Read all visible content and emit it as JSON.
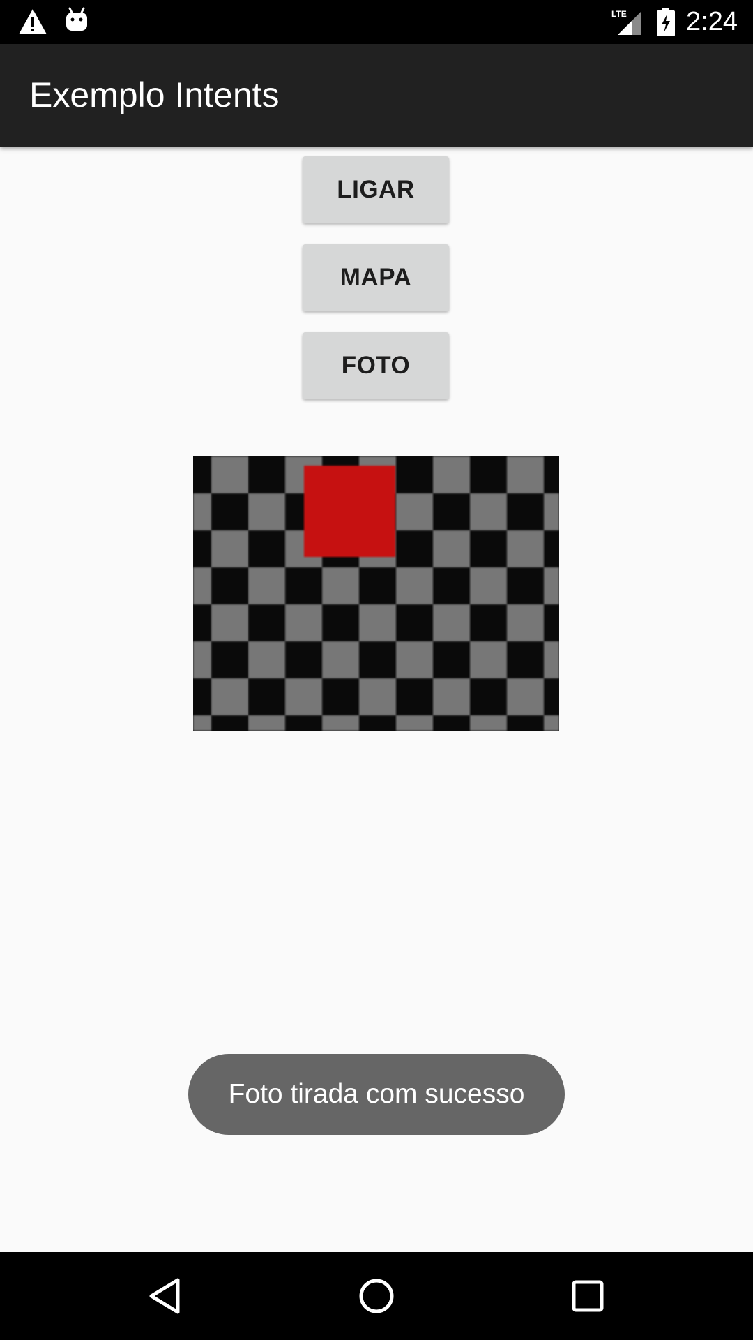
{
  "status_bar": {
    "time": "2:24",
    "left_icons": [
      "warning-icon",
      "android-icon"
    ],
    "right_icons": [
      "lte-signal-icon",
      "battery-charging-icon"
    ],
    "network_label": "LTE"
  },
  "app_bar": {
    "title": "Exemplo Intents",
    "background": "#212121"
  },
  "buttons": {
    "ligar": "LIGAR",
    "mapa": "MAPA",
    "foto": "FOTO"
  },
  "photo": {
    "description_icon": "checkerboard-photo",
    "colors": {
      "dark": "#0a0a0a",
      "light": "#777777",
      "red_square": "#c61111"
    }
  },
  "toast": {
    "message": "Foto tirada com sucesso"
  },
  "nav_bar": {
    "buttons": [
      "back-icon",
      "home-icon",
      "recents-icon"
    ]
  }
}
